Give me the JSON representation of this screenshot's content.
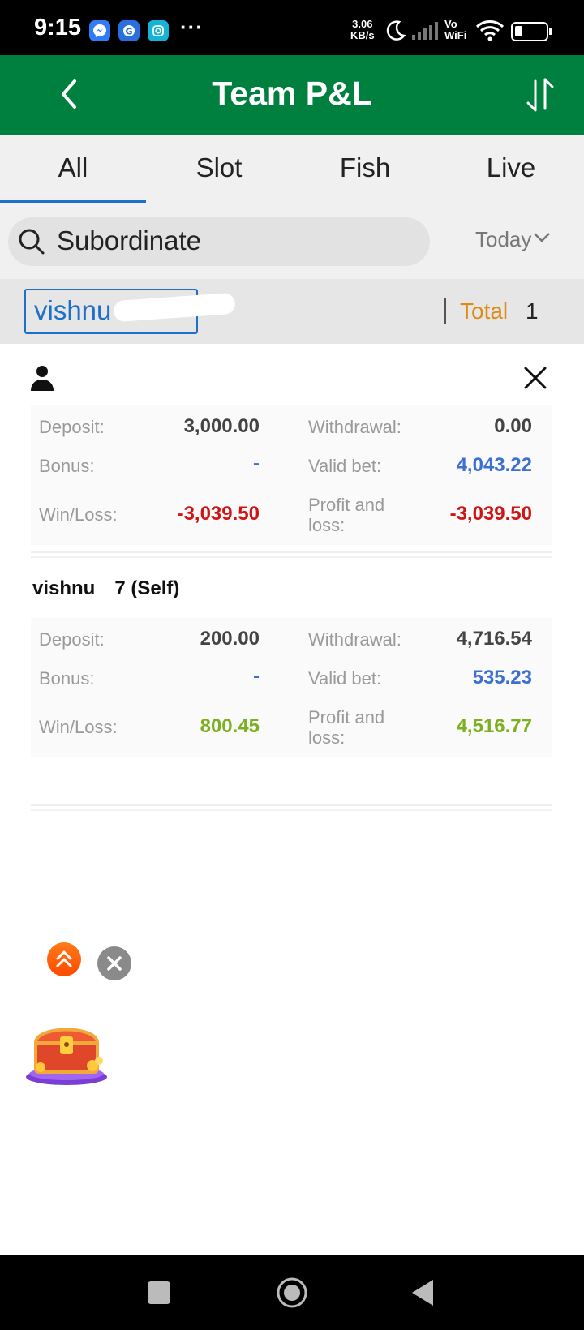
{
  "status_bar": {
    "time": "9:15",
    "more": "···",
    "speed_value": "3.06",
    "speed_unit": "KB/s",
    "vowifi_top": "Vo",
    "vowifi_bottom": "WiFi",
    "icons": [
      "messenger-icon",
      "google-icon",
      "instagram-icon",
      "moon-icon",
      "signal-icon",
      "wifi-icon",
      "battery-icon"
    ]
  },
  "header": {
    "title": "Team P&L"
  },
  "tabs": [
    {
      "label": "All",
      "active": true
    },
    {
      "label": "Slot",
      "active": false
    },
    {
      "label": "Fish",
      "active": false
    },
    {
      "label": "Live",
      "active": false
    }
  ],
  "search": {
    "placeholder": "Subordinate",
    "date_filter": "Today"
  },
  "underlying": {
    "username": "vishnu",
    "total_label": "Total",
    "total_value": "1"
  },
  "sheet": {
    "member_name": "",
    "summary": {
      "deposit_label": "Deposit:",
      "deposit": "3,000.00",
      "withdrawal_label": "Withdrawal:",
      "withdrawal": "0.00",
      "bonus_label": "Bonus:",
      "bonus": "-",
      "validbet_label": "Valid bet:",
      "validbet": "4,043.22",
      "winloss_label": "Win/Loss:",
      "winloss": "-3,039.50",
      "pnl_label_1": "Profit and",
      "pnl_label_2": "loss:",
      "pnl": "-3,039.50"
    },
    "self_title": "vishnu     7 (Self)",
    "self": {
      "deposit_label": "Deposit:",
      "deposit": "200.00",
      "withdrawal_label": "Withdrawal:",
      "withdrawal": "4,716.54",
      "bonus_label": "Bonus:",
      "bonus": "-",
      "validbet_label": "Valid bet:",
      "validbet": "535.23",
      "winloss_label": "Win/Loss:",
      "winloss": "800.45",
      "pnl_label_1": "Profit and",
      "pnl_label_2": "loss:",
      "pnl": "4,516.77"
    }
  },
  "colors": {
    "header_green": "#00803e",
    "accent_blue": "#1e6fc9",
    "loss_red": "#d01414",
    "profit_green": "#7cb020",
    "total_orange": "#e08a16"
  }
}
